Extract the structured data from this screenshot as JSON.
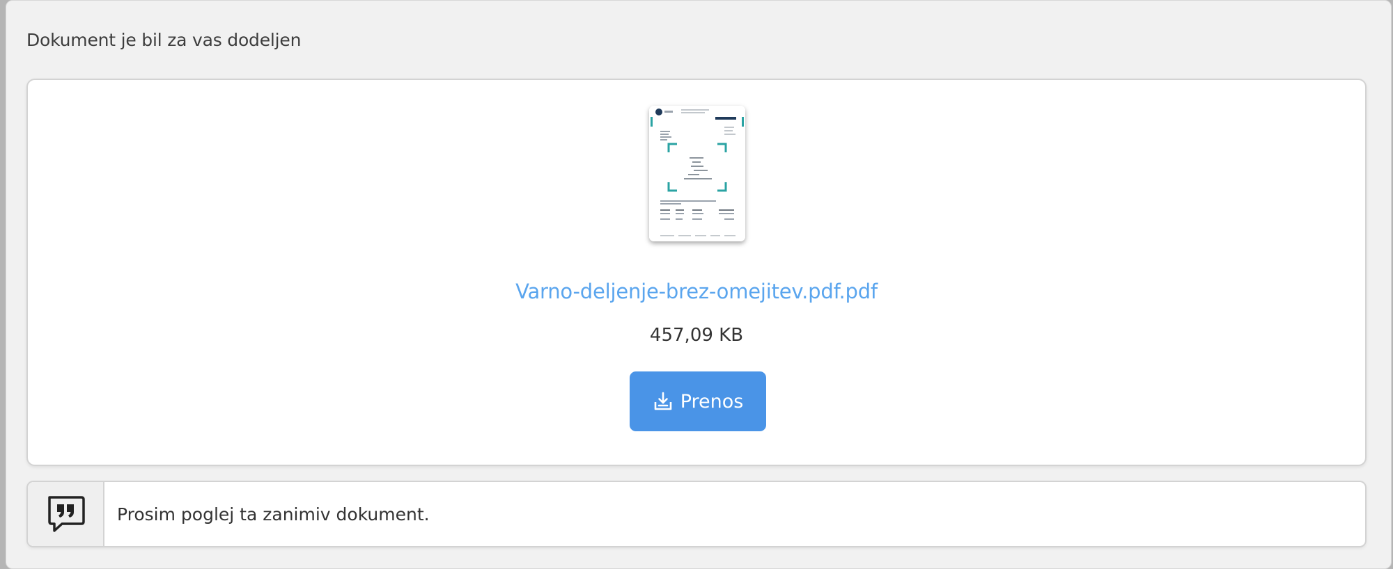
{
  "header": {
    "title": "Dokument je bil za vas dodeljen"
  },
  "file": {
    "name": "Varno-deljenje-brez-omejitev.pdf.pdf",
    "size": "457,09 KB",
    "thumbnail_icon": "pdf-page-thumbnail"
  },
  "actions": {
    "download_label": "Prenos",
    "download_icon": "download-tray-icon"
  },
  "message": {
    "icon": "quote-bubble-icon",
    "text": "Prosim poglej ta zanimiv dokument."
  },
  "colors": {
    "accent": "#4a94e7",
    "link": "#5aa5ee"
  }
}
